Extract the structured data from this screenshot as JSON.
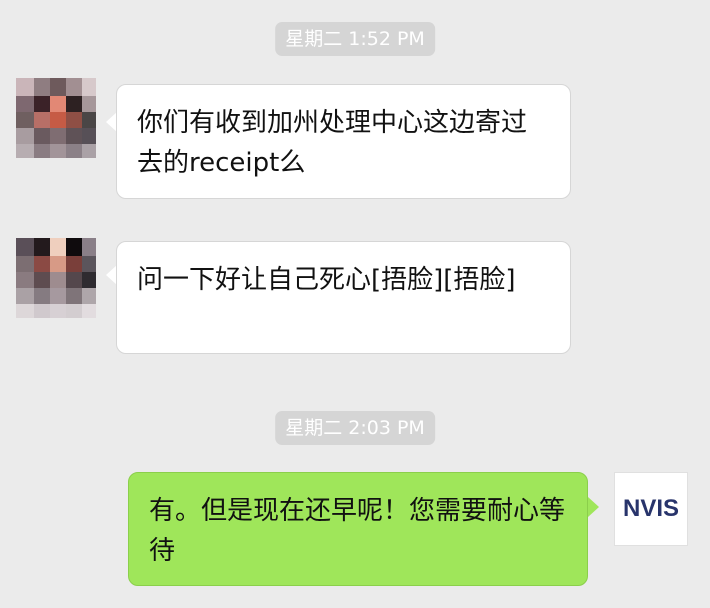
{
  "messages": [
    {
      "timestamp": "星期二 1:52 PM",
      "sender": "other",
      "text": "你们有收到加州处理中心这边寄过去的receipt么"
    },
    {
      "sender": "other",
      "text": "问一下好让自己死心[捂脸][捂脸]"
    },
    {
      "timestamp": "星期二 2:03 PM",
      "sender": "me",
      "text": "有。但是现在还早呢！您需要耐心等待"
    }
  ],
  "timestamps": {
    "first": "星期二 1:52 PM",
    "second": "星期二 2:03 PM"
  },
  "avatars": {
    "self_logo": "NVIS",
    "other_avatar_icon": "pixelated-avatar-icon"
  },
  "colors": {
    "chat_background": "#ebebeb",
    "incoming_bubble": "#ffffff",
    "outgoing_bubble": "#9fe65a",
    "timestamp_pill": "#d5d5d5",
    "logo_text": "#28346b"
  }
}
